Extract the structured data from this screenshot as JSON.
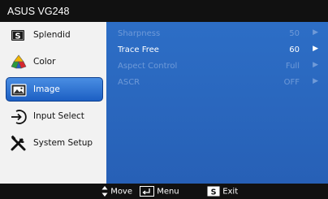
{
  "window": {
    "title": "ASUS VG248"
  },
  "sidebar": {
    "items": [
      {
        "label": "Splendid",
        "icon": "splendid-s-icon"
      },
      {
        "label": "Color",
        "icon": "color-palette-icon"
      },
      {
        "label": "Image",
        "icon": "image-icon",
        "selected": true
      },
      {
        "label": "Input Select",
        "icon": "input-select-icon"
      },
      {
        "label": "System Setup",
        "icon": "system-setup-tools-icon"
      }
    ]
  },
  "settings": [
    {
      "name": "Sharpness",
      "value": "50",
      "enabled": false
    },
    {
      "name": "Trace Free",
      "value": "60",
      "enabled": true
    },
    {
      "name": "Aspect Control",
      "value": "Full",
      "enabled": false
    },
    {
      "name": "ASCR",
      "value": "OFF",
      "enabled": false
    }
  ],
  "footer": {
    "move_label": "Move",
    "menu_label": "Menu",
    "exit_label": "Exit",
    "exit_key": "S"
  },
  "colors": {
    "selected_bg": "#2f72d6",
    "panel_bg": "#2d6ec6",
    "sidebar_bg": "#f2f2f2",
    "bar_bg": "#111111"
  }
}
